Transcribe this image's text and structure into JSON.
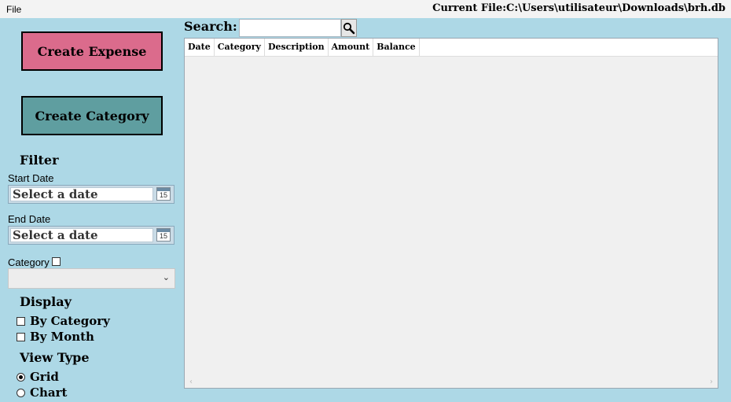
{
  "menu": {
    "file": "File"
  },
  "current_file": "Current File:C:\\Users\\utilisateur\\Downloads\\brh.db",
  "buttons": {
    "create_expense": "Create Expense",
    "create_category": "Create Category"
  },
  "filter": {
    "heading": "Filter",
    "start_date_label": "Start Date",
    "start_date_value": "Select a date",
    "end_date_label": "End Date",
    "end_date_value": "Select a date",
    "calendar_day": "15",
    "category_label": "Category"
  },
  "display": {
    "heading": "Display",
    "by_category": "By Category",
    "by_month": "By Month"
  },
  "view_type": {
    "heading": "View Type",
    "grid": "Grid",
    "chart": "Chart"
  },
  "search": {
    "label": "Search:"
  },
  "grid": {
    "columns": [
      "Date",
      "Category",
      "Description",
      "Amount",
      "Balance"
    ],
    "scroll_left": "‹",
    "scroll_right": "›"
  },
  "colors": {
    "background": "#add8e6",
    "expense_button": "#db6b8c",
    "category_button": "#5f9ea0"
  }
}
